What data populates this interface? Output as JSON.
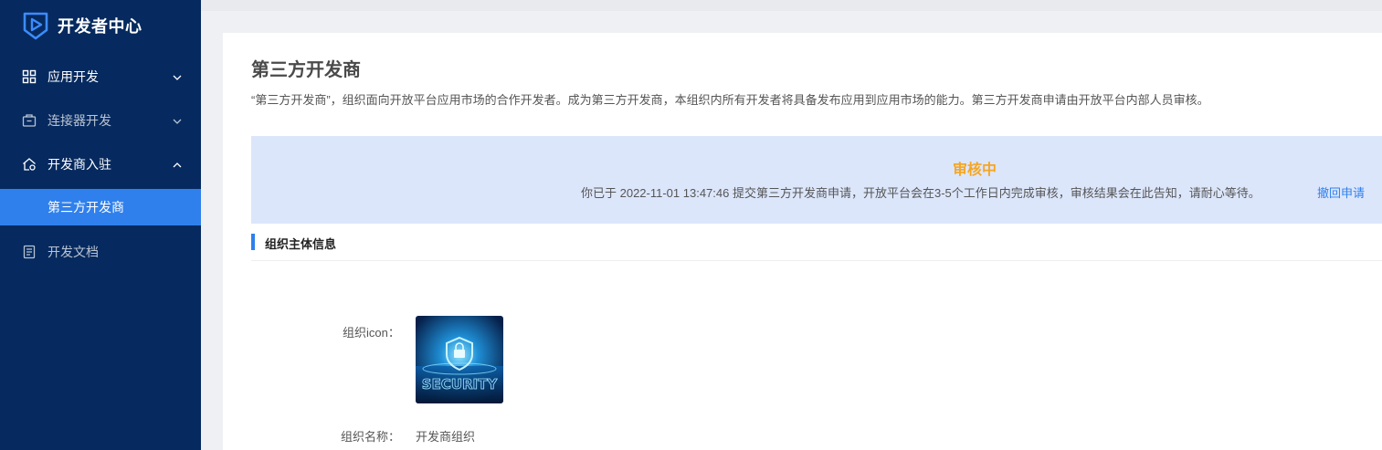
{
  "app": {
    "title": "开发者中心"
  },
  "sidebar": {
    "items": [
      {
        "label": "应用开发",
        "icon": "grid-icon",
        "expanded": false
      },
      {
        "label": "连接器开发",
        "icon": "connector-box-icon",
        "expanded": false
      },
      {
        "label": "开发商入驻",
        "icon": "home-gear-icon",
        "expanded": true
      },
      {
        "label": "第三方开发商",
        "active": true
      },
      {
        "label": "开发文档",
        "icon": "document-icon"
      }
    ]
  },
  "page": {
    "title": "第三方开发商",
    "description": "“第三方开发商”，组织面向开放平台应用市场的合作开发者。成为第三方开发商，本组织内所有开发者将具备发布应用到应用市场的能力。第三方开发商申请由开放平台内部人员审核。"
  },
  "status": {
    "title": "审核中",
    "message": "你已于 2022-11-01 13:47:46 提交第三方开发商申请，开放平台会在3-5个工作日内完成审核，审核结果会在此告知，请耐心等待。",
    "withdraw_label": "撤回申请"
  },
  "section": {
    "title": "组织主体信息"
  },
  "fields": {
    "icon_label": "组织icon：",
    "icon_image_text": "SECURITY",
    "name_label": "组织名称：",
    "name_value": "开发商组织"
  },
  "colors": {
    "sidebar_bg": "#062a5f",
    "accent": "#2f80ed",
    "status_bg": "#dce6fb",
    "status_text": "#f5a623"
  }
}
